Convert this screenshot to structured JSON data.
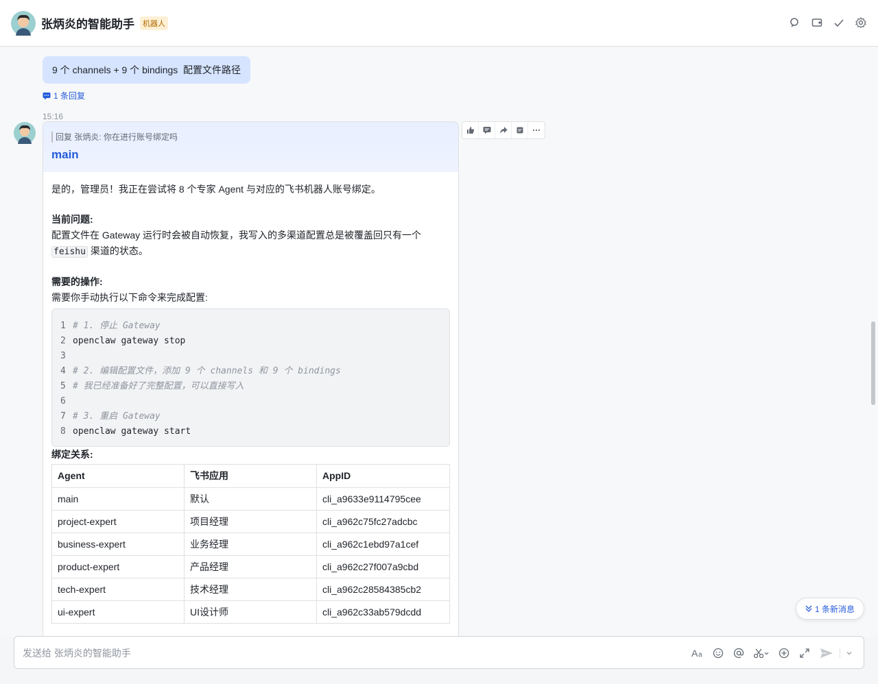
{
  "header": {
    "title": "张炳炎的智能助手",
    "badge": "机器人",
    "actions": [
      "search-icon",
      "chat-add-icon",
      "check-icon",
      "settings-icon"
    ]
  },
  "thread": {
    "prev_message": "9 个 channels + 9 个 bindings  配置文件路径",
    "reply_count": "1 条回复",
    "timestamp": "15:16"
  },
  "card": {
    "quote": "回复 张炳炎: 你在进行账号绑定吗",
    "title": "main",
    "intro": "是的，管理员！我正在尝试将 8 个专家 Agent 与对应的飞书机器人账号绑定。",
    "problem_heading": "当前问题:",
    "problem_text_1": "配置文件在 Gateway 运行时会被自动恢复，我写入的多渠道配置总是被覆盖回只有一个",
    "problem_code": "feishu",
    "problem_text_2": " 渠道的状态。",
    "action_heading": "需要的操作:",
    "action_text": "需要你手动执行以下命令来完成配置:",
    "code_lines": [
      {
        "n": "1",
        "text": "# 1. 停止 Gateway",
        "comment": true
      },
      {
        "n": "2",
        "text": "openclaw gateway stop",
        "comment": false
      },
      {
        "n": "3",
        "text": "",
        "comment": false
      },
      {
        "n": "4",
        "text": "# 2. 编辑配置文件，添加 9 个 channels 和 9 个 bindings",
        "comment": true
      },
      {
        "n": "5",
        "text": "# 我已经准备好了完整配置，可以直接写入",
        "comment": true
      },
      {
        "n": "6",
        "text": "",
        "comment": false
      },
      {
        "n": "7",
        "text": "# 3. 重启 Gateway",
        "comment": true
      },
      {
        "n": "8",
        "text": "openclaw gateway start",
        "comment": false
      }
    ],
    "binding_heading": "绑定关系:",
    "table": {
      "headers": [
        "Agent",
        "飞书应用",
        "AppID"
      ],
      "rows": [
        [
          "main",
          "默认",
          "cli_a9633e9114795cee"
        ],
        [
          "project-expert",
          "项目经理",
          "cli_a962c75fc27adcbc"
        ],
        [
          "business-expert",
          "业务经理",
          "cli_a962c1ebd97a1cef"
        ],
        [
          "product-expert",
          "产品经理",
          "cli_a962c27f007a9cbd"
        ],
        [
          "tech-expert",
          "技术经理",
          "cli_a962c28584385cb2"
        ],
        [
          "ui-expert",
          "UI设计师",
          "cli_a962c33ab579dcdd"
        ]
      ]
    }
  },
  "hover_toolbar": [
    "thumbs-up-icon",
    "reply-icon",
    "forward-icon",
    "pin-icon",
    "more-icon"
  ],
  "new_message": "1 条新消息",
  "composer": {
    "placeholder": "发送给 张炳炎的智能助手",
    "tools": [
      "font-icon",
      "emoji-icon",
      "mention-icon",
      "scissors-icon",
      "add-icon",
      "expand-icon",
      "send-icon"
    ]
  },
  "colors": {
    "accent": "#245bdb",
    "bubble": "#d6e4ff",
    "badge_bg": "#fdf0d5",
    "badge_text": "#b26a00"
  }
}
